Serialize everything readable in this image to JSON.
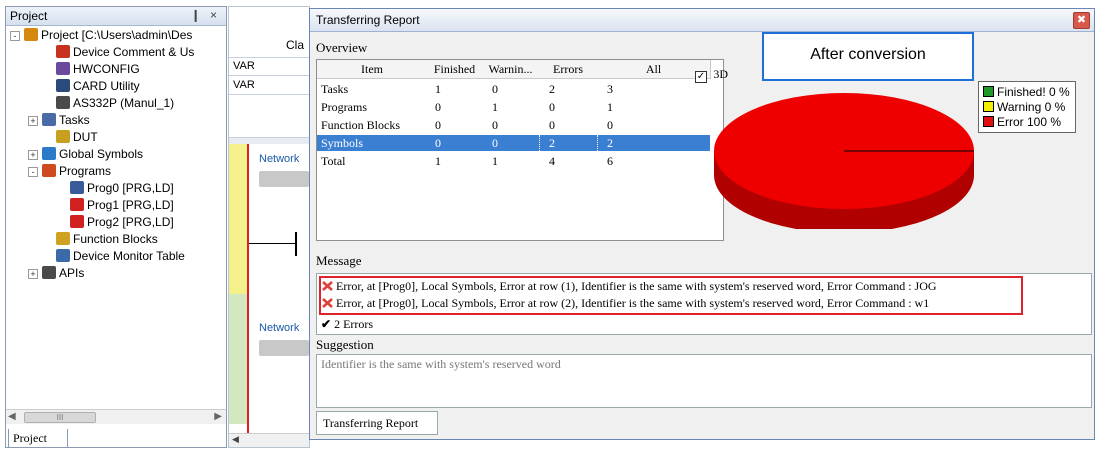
{
  "project_panel": {
    "title": "Project",
    "controls": "❙ ×",
    "tree": [
      {
        "label": "Project [C:\\Users\\admin\\Des",
        "icon": "project-icon",
        "color": "#d4880e"
      },
      {
        "label": "Device Comment & Us",
        "icon": "device-comment-icon",
        "color": "#c83020"
      },
      {
        "label": "HWCONFIG",
        "icon": "hwconfig-icon",
        "color": "#6a4a9a"
      },
      {
        "label": "CARD Utility",
        "icon": "card-utility-icon",
        "color": "#2a4a7a"
      },
      {
        "label": "AS332P  (Manul_1)",
        "icon": "plc-icon",
        "color": "#4a4a4a"
      },
      {
        "label": "Tasks",
        "icon": "tasks-icon",
        "color": "#4a6aa8"
      },
      {
        "label": "DUT",
        "icon": "dut-icon",
        "color": "#c8a020"
      },
      {
        "label": "Global Symbols",
        "icon": "global-symbols-icon",
        "color": "#2a7ac8"
      },
      {
        "label": "Programs",
        "icon": "programs-icon",
        "color": "#d04a20"
      },
      {
        "label": "Prog0 [PRG,LD]",
        "icon": "prog-icon",
        "color": "#3a5a9a"
      },
      {
        "label": "Prog1 [PRG,LD]",
        "icon": "prog-error-icon",
        "color": "#d02020"
      },
      {
        "label": "Prog2 [PRG,LD]",
        "icon": "prog-error-icon",
        "color": "#d02020"
      },
      {
        "label": "Function Blocks",
        "icon": "function-blocks-icon",
        "color": "#d0a020"
      },
      {
        "label": "Device Monitor Table",
        "icon": "device-monitor-icon",
        "color": "#3a6aa8"
      },
      {
        "label": "APIs",
        "icon": "apis-icon",
        "color": "#4a4a4a"
      }
    ],
    "scroll_label": "III",
    "tab": "Project"
  },
  "editor": {
    "header": "Cla",
    "rows": [
      "VAR",
      "VAR"
    ],
    "network_label": "Network",
    "network2_label": "Network"
  },
  "dialog": {
    "title": "Transferring Report",
    "overview_label": "Overview",
    "columns": [
      "Item",
      "Finished",
      "Warnin...",
      "Errors",
      "All"
    ],
    "rows": [
      {
        "item": "Tasks",
        "finished": "1",
        "warning": "0",
        "errors": "2",
        "all": "3"
      },
      {
        "item": "Programs",
        "finished": "0",
        "warning": "1",
        "errors": "0",
        "all": "1"
      },
      {
        "item": "Function Blocks",
        "finished": "0",
        "warning": "0",
        "errors": "0",
        "all": "0"
      },
      {
        "item": "Symbols",
        "finished": "0",
        "warning": "0",
        "errors": "2",
        "all": "2"
      },
      {
        "item": "Total",
        "finished": "1",
        "warning": "1",
        "errors": "4",
        "all": "6"
      }
    ],
    "checkbox_3d": "3D",
    "message_label": "Message",
    "messages": [
      "Error, at [Prog0], Local Symbols, Error at row (1), Identifier is the same with system's reserved word, Error Command : JOG",
      "Error, at [Prog0], Local Symbols, Error at row (2), Identifier is the same with system's reserved word, Error Command : w1"
    ],
    "error_count": "2 Errors",
    "suggestion_label": "Suggestion",
    "suggestion_text": "Identifier is the same with system's reserved word",
    "bottom_tab": "Transferring Report",
    "callout": "After conversion",
    "legend": [
      {
        "label": "Finished! 0 %",
        "color": "#1e9a2a"
      },
      {
        "label": "Warning 0 %",
        "color": "#f4f000"
      },
      {
        "label": "Error 100 %",
        "color": "#e01010"
      }
    ],
    "pie_color": "#ee0000",
    "pie_edge_color": "#b00000"
  }
}
